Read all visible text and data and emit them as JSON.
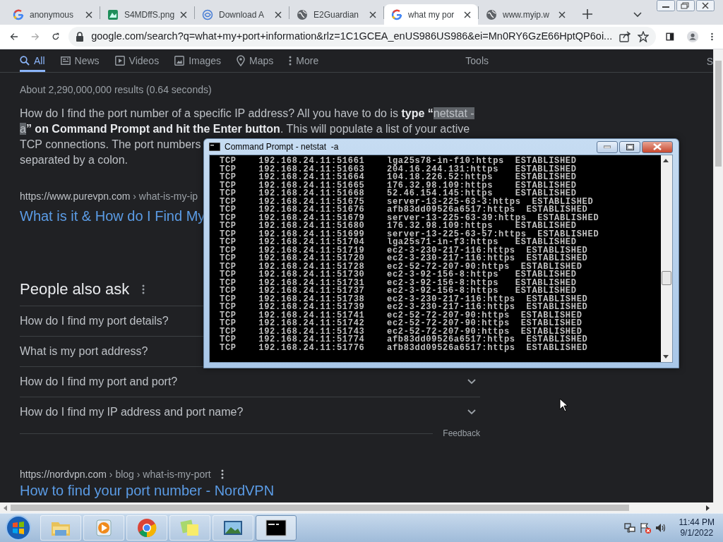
{
  "browser": {
    "tabs": [
      {
        "title": "anonymous",
        "kind": "google",
        "selected": false
      },
      {
        "title": "S4MDffS.png",
        "kind": "image",
        "selected": false
      },
      {
        "title": "Download A",
        "kind": "swirl",
        "selected": false
      },
      {
        "title": "E2Guardian",
        "kind": "globe",
        "selected": false
      },
      {
        "title": "what my por",
        "kind": "google",
        "selected": true
      },
      {
        "title": "www.myip.w",
        "kind": "globe",
        "selected": false
      }
    ],
    "address": "google.com/search?q=what+my+port+information&rlz=1C1GCEA_enUS986US986&ei=Mn0RY6GzE66HptQP6oi..."
  },
  "search_nav": {
    "tabs": [
      {
        "label": "All",
        "kind": "search",
        "selected": true
      },
      {
        "label": "News",
        "kind": "news",
        "selected": false
      },
      {
        "label": "Videos",
        "kind": "video",
        "selected": false
      },
      {
        "label": "Images",
        "kind": "image",
        "selected": false
      },
      {
        "label": "Maps",
        "kind": "pin",
        "selected": false
      },
      {
        "label": "More",
        "kind": "more",
        "selected": false
      }
    ],
    "tools": "Tools",
    "edge_text": "S"
  },
  "result_stats": "About 2,290,000,000 results (0.64 seconds)",
  "snippet": {
    "lines": [
      [
        {
          "text": "How do I find the port number of a specific IP address? All you have to do is "
        },
        {
          "text": "type “",
          "bold": true
        },
        {
          "text": "netstat -",
          "highlight": true
        }
      ],
      [
        {
          "text": "a",
          "highlight": true
        },
        {
          "text": "” on Command Prompt and hit the Enter button",
          "bold": true
        },
        {
          "text": ". This will populate a list of your active"
        }
      ],
      [
        {
          "text": "TCP connections. The port numbers"
        }
      ],
      [
        {
          "text": "separated by a colon."
        }
      ]
    ]
  },
  "results": [
    {
      "url": "https://www.purevpn.com › what-is-my-ip",
      "title": "What is it & How do I Find My",
      "menu": false
    }
  ],
  "people_also_ask": {
    "title": "People also ask",
    "questions": [
      {
        "text": "How do I find my port details?"
      },
      {
        "text": "What is my port address?"
      },
      {
        "text": "How do I find my port and port?",
        "chevron": true
      },
      {
        "text": "How do I find my IP address and port name?",
        "chevron": true
      }
    ],
    "feedback": "Feedback"
  },
  "results_after": [
    {
      "url": "https://nordvpn.com › blog › what-is-my-port",
      "title": "How to find your port number - NordVPN",
      "menu": true
    }
  ],
  "console": {
    "title": "Command Prompt - netstat  -a",
    "lines": [
      "TCP    192.168.24.11:51661    lga25s78-in-f10:https  ESTABLISHED",
      "TCP    192.168.24.11:51663    204.16.244.131:https   ESTABLISHED",
      "TCP    192.168.24.11:51664    104.18.226.52:https    ESTABLISHED",
      "TCP    192.168.24.11:51665    176.32.98.109:https    ESTABLISHED",
      "TCP    192.168.24.11:51668    52.46.154.145:https    ESTABLISHED",
      "TCP    192.168.24.11:51675    server-13-225-63-3:https  ESTABLISHED",
      "TCP    192.168.24.11:51676    afb83dd09526a6517:https  ESTABLISHED",
      "TCP    192.168.24.11:51679    server-13-225-63-39:https  ESTABLISHED",
      "TCP    192.168.24.11:51680    176.32.98.109:https    ESTABLISHED",
      "TCP    192.168.24.11:51699    server-13-225-63-57:https  ESTABLISHED",
      "TCP    192.168.24.11:51704    lga25s71-in-f3:https   ESTABLISHED",
      "TCP    192.168.24.11:51719    ec2-3-230-217-116:https  ESTABLISHED",
      "TCP    192.168.24.11:51720    ec2-3-230-217-116:https  ESTABLISHED",
      "TCP    192.168.24.11:51728    ec2-52-72-207-90:https  ESTABLISHED",
      "TCP    192.168.24.11:51730    ec2-3-92-156-8:https   ESTABLISHED",
      "TCP    192.168.24.11:51731    ec2-3-92-156-8:https   ESTABLISHED",
      "TCP    192.168.24.11:51737    ec2-3-92-156-8:https   ESTABLISHED",
      "TCP    192.168.24.11:51738    ec2-3-230-217-116:https  ESTABLISHED",
      "TCP    192.168.24.11:51739    ec2-3-230-217-116:https  ESTABLISHED",
      "TCP    192.168.24.11:51741    ec2-52-72-207-90:https  ESTABLISHED",
      "TCP    192.168.24.11:51742    ec2-52-72-207-90:https  ESTABLISHED",
      "TCP    192.168.24.11:51743    ec2-52-72-207-90:https  ESTABLISHED",
      "TCP    192.168.24.11:51774    afb83dd09526a6517:https  ESTABLISHED",
      "TCP    192.168.24.11:51776    afb83dd09526a6517:https  ESTABLISHED"
    ]
  },
  "taskbar": {
    "apps": [
      {
        "kind": "folder",
        "selected": false
      },
      {
        "kind": "media",
        "selected": false
      },
      {
        "kind": "chrome",
        "selected": false
      },
      {
        "kind": "notes",
        "selected": false
      },
      {
        "kind": "photo",
        "selected": false
      },
      {
        "kind": "console",
        "selected": true
      }
    ],
    "time": "11:44 PM",
    "date": "9/1/2022"
  }
}
